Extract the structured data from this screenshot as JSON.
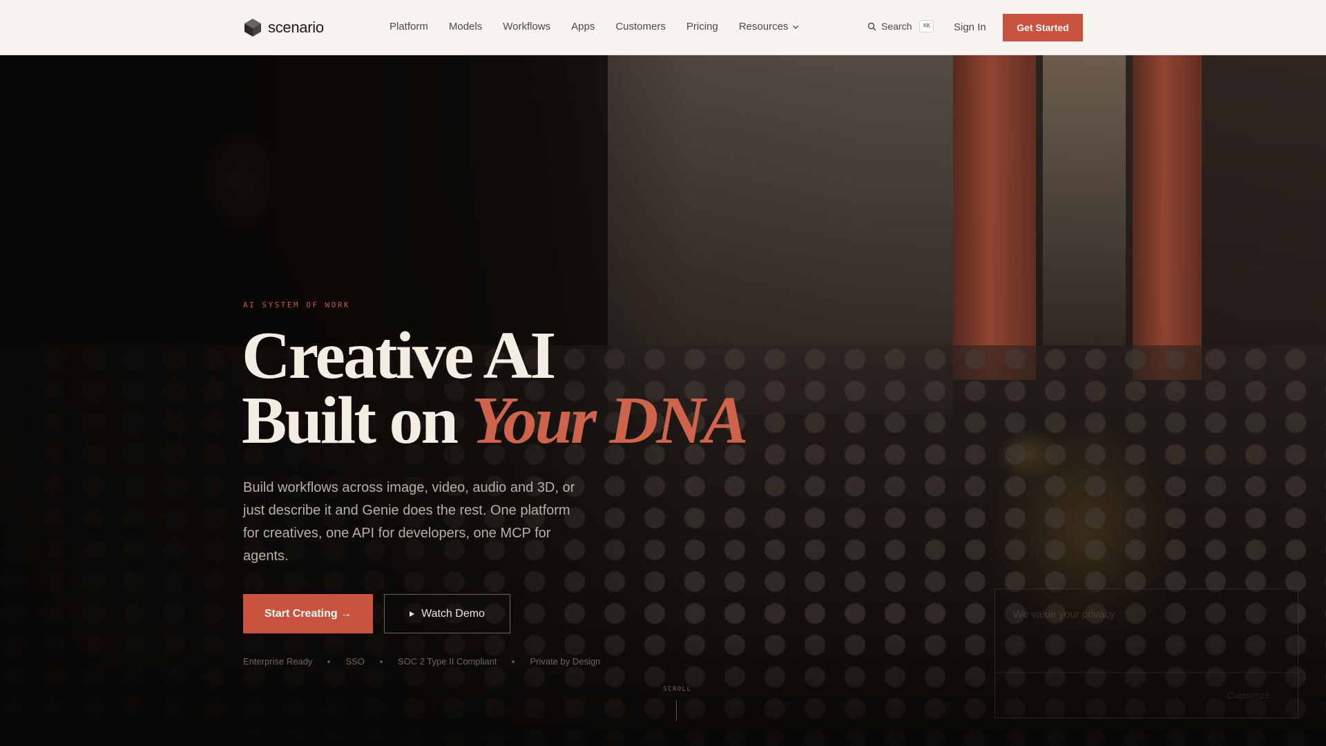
{
  "nav": {
    "logo_text": "scenario",
    "links": [
      "Platform",
      "Models",
      "Workflows",
      "Apps",
      "Customers",
      "Pricing",
      "Resources"
    ],
    "search_label": "Search",
    "search_shortcut": "⌘K",
    "sign_in": "Sign In",
    "get_started": "Get Started"
  },
  "hero": {
    "eyebrow": "AI SYSTEM OF WORK",
    "headline_line1": "Creative AI",
    "headline_line2": "Built on ",
    "headline_accent": "Your DNA",
    "subtext": "Build workflows across image, video, audio and 3D, or just describe it and Genie does the rest. One platform for creatives, one API for developers, one MCP for agents.",
    "primary_cta": "Start Creating →",
    "secondary_cta": "Watch Demo",
    "badges": [
      "Enterprise Ready",
      "SSO",
      "SOC 2 Type II Compliant",
      "Private by Design"
    ],
    "scroll_label": "SCROLL"
  },
  "card": {
    "title": "We value your privacy",
    "side_text": "",
    "link": "Customize"
  },
  "colors": {
    "accent": "#c9533c",
    "nav_bg": "#f7f4ef",
    "hero_bg": "#0e0b09"
  }
}
